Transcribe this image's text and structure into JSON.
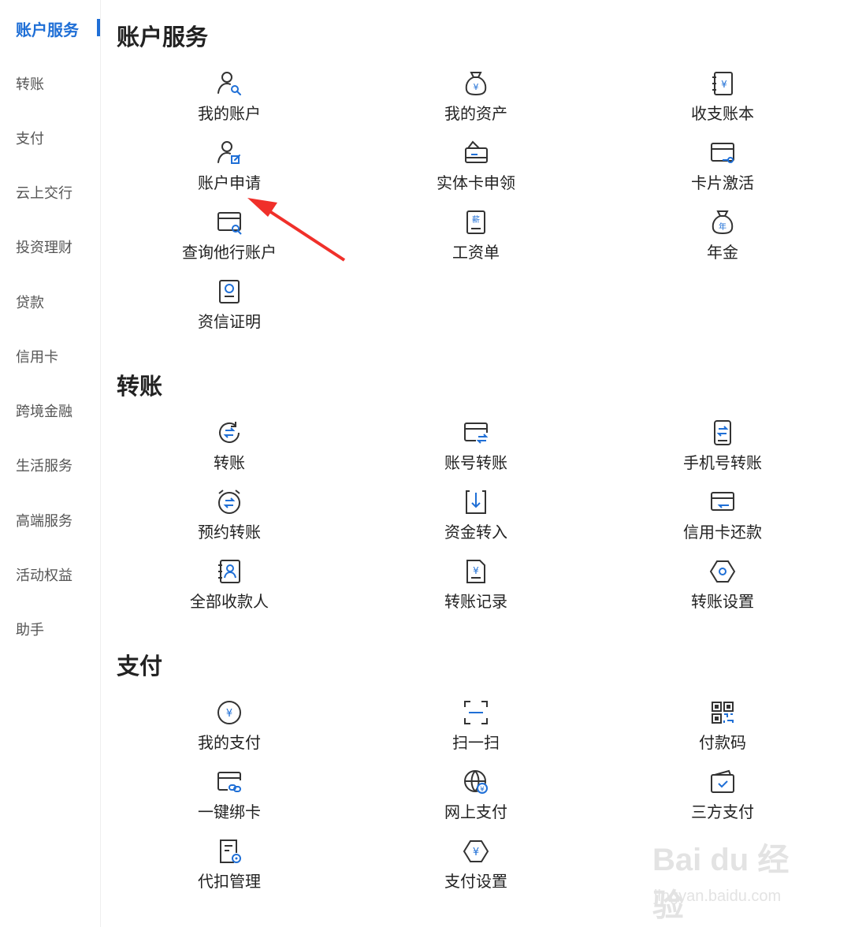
{
  "sidebar": {
    "items": [
      {
        "label": "账户服务",
        "active": true
      },
      {
        "label": "转账"
      },
      {
        "label": "支付"
      },
      {
        "label": "云上交行"
      },
      {
        "label": "投资理财"
      },
      {
        "label": "贷款"
      },
      {
        "label": "信用卡"
      },
      {
        "label": "跨境金融"
      },
      {
        "label": "生活服务"
      },
      {
        "label": "高端服务"
      },
      {
        "label": "活动权益"
      },
      {
        "label": "助手"
      }
    ]
  },
  "sections": [
    {
      "title": "账户服务",
      "items": [
        {
          "label": "我的账户",
          "icon": "user-search-icon"
        },
        {
          "label": "我的资产",
          "icon": "money-bag-icon"
        },
        {
          "label": "收支账本",
          "icon": "ledger-icon"
        },
        {
          "label": "账户申请",
          "icon": "user-edit-icon"
        },
        {
          "label": "实体卡申领",
          "icon": "card-apply-icon"
        },
        {
          "label": "卡片激活",
          "icon": "card-key-icon"
        },
        {
          "label": "查询他行账户",
          "icon": "card-search-icon"
        },
        {
          "label": "工资单",
          "icon": "salary-slip-icon"
        },
        {
          "label": "年金",
          "icon": "annuity-bag-icon"
        },
        {
          "label": "资信证明",
          "icon": "certificate-icon"
        }
      ]
    },
    {
      "title": "转账",
      "items": [
        {
          "label": "转账",
          "icon": "transfer-icon"
        },
        {
          "label": "账号转账",
          "icon": "account-transfer-icon"
        },
        {
          "label": "手机号转账",
          "icon": "phone-transfer-icon"
        },
        {
          "label": "预约转账",
          "icon": "scheduled-transfer-icon"
        },
        {
          "label": "资金转入",
          "icon": "fund-in-icon"
        },
        {
          "label": "信用卡还款",
          "icon": "credit-repay-icon"
        },
        {
          "label": "全部收款人",
          "icon": "payee-book-icon"
        },
        {
          "label": "转账记录",
          "icon": "transfer-record-icon"
        },
        {
          "label": "转账设置",
          "icon": "settings-hex-icon"
        }
      ]
    },
    {
      "title": "支付",
      "items": [
        {
          "label": "我的支付",
          "icon": "yuan-circle-icon"
        },
        {
          "label": "扫一扫",
          "icon": "scan-icon"
        },
        {
          "label": "付款码",
          "icon": "qr-code-icon"
        },
        {
          "label": "一键绑卡",
          "icon": "card-link-icon"
        },
        {
          "label": "网上支付",
          "icon": "globe-yuan-icon"
        },
        {
          "label": "三方支付",
          "icon": "wallet-check-icon"
        },
        {
          "label": "代扣管理",
          "icon": "doc-settings-icon"
        },
        {
          "label": "支付设置",
          "icon": "yuan-hex-icon"
        }
      ]
    }
  ],
  "watermark": {
    "brand": "Bai du 经验",
    "url": "jingyan.baidu.com"
  },
  "colors": {
    "accent": "#1f6fd6",
    "arrow": "#f0302a"
  }
}
